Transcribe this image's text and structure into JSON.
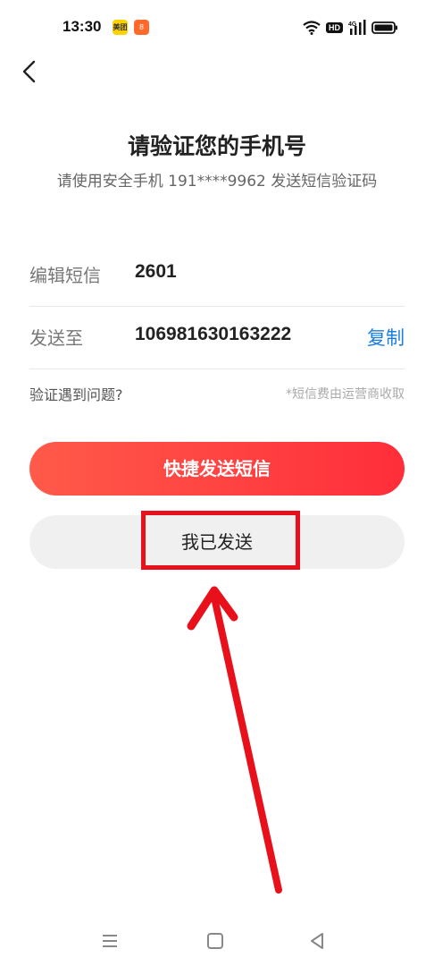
{
  "status_bar": {
    "time": "13:30",
    "app_badge_1": "美团",
    "app_badge_2": "8",
    "network_label": "HD",
    "signal_label": "4G"
  },
  "header": {
    "title": "请验证您的手机号",
    "subtitle": "请使用安全手机 191****9962 发送短信验证码"
  },
  "form": {
    "sms_label": "编辑短信",
    "sms_value": "2601",
    "send_to_label": "发送至",
    "send_to_value": "106981630163222",
    "copy_label": "复制"
  },
  "help": {
    "question_link": "验证遇到问题?",
    "fee_note": "*短信费由运营商收取"
  },
  "actions": {
    "quick_send_label": "快捷发送短信",
    "sent_label": "我已发送"
  },
  "colors": {
    "primary_button": "#ff3a3f",
    "link": "#1a7ee0",
    "annotation": "#e8101a"
  }
}
